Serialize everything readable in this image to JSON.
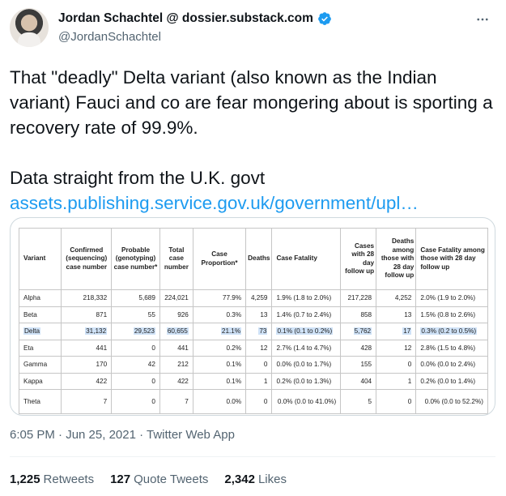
{
  "author": {
    "display_name": "Jordan Schachtel @ dossier.substack.com",
    "handle": "@JordanSchachtel"
  },
  "tweet": {
    "line1": "That \"deadly\" Delta variant (also known as the Indian variant) Fauci and co are fear mongering about is sporting a recovery rate of 99.9%.",
    "line2": "Data straight from the U.K. govt",
    "link": "assets.publishing.service.gov.uk/government/upl…"
  },
  "table": {
    "headers": {
      "variant": "Variant",
      "confirmed": "Confirmed (sequencing) case number",
      "probable": "Probable (genotyping) case number*",
      "total": "Total case number",
      "proportion": "Case Proportion*",
      "deaths": "Deaths",
      "cfr": "Case Fatality",
      "cases28": "Cases with 28 day follow up",
      "deaths28": "Deaths among those with 28 day follow up",
      "cfr28": "Case Fatality among those with 28 day follow up"
    },
    "rows": [
      {
        "variant": "Alpha",
        "confirmed": "218,332",
        "probable": "5,689",
        "total": "224,021",
        "proportion": "77.9%",
        "deaths": "4,259",
        "cfr": "1.9% (1.8 to 2.0%)",
        "cases28": "217,228",
        "deaths28": "4,252",
        "cfr28": "2.0% (1.9 to 2.0%)"
      },
      {
        "variant": "Beta",
        "confirmed": "871",
        "probable": "55",
        "total": "926",
        "proportion": "0.3%",
        "deaths": "13",
        "cfr": "1.4% (0.7 to 2.4%)",
        "cases28": "858",
        "deaths28": "13",
        "cfr28": "1.5% (0.8 to 2.6%)"
      },
      {
        "variant": "Delta",
        "confirmed": "31,132",
        "probable": "29,523",
        "total": "60,655",
        "proportion": "21.1%",
        "deaths": "73",
        "cfr": "0.1% (0.1 to 0.2%)",
        "cases28": "5,762",
        "deaths28": "17",
        "cfr28": "0.3% (0.2 to 0.5%)"
      },
      {
        "variant": "Eta",
        "confirmed": "441",
        "probable": "0",
        "total": "441",
        "proportion": "0.2%",
        "deaths": "12",
        "cfr": "2.7% (1.4 to 4.7%)",
        "cases28": "428",
        "deaths28": "12",
        "cfr28": "2.8% (1.5 to 4.8%)"
      },
      {
        "variant": "Gamma",
        "confirmed": "170",
        "probable": "42",
        "total": "212",
        "proportion": "0.1%",
        "deaths": "0",
        "cfr": "0.0% (0.0 to 1.7%)",
        "cases28": "155",
        "deaths28": "0",
        "cfr28": "0.0% (0.0 to 2.4%)"
      },
      {
        "variant": "Kappa",
        "confirmed": "422",
        "probable": "0",
        "total": "422",
        "proportion": "0.1%",
        "deaths": "1",
        "cfr": "0.2% (0.0 to 1.3%)",
        "cases28": "404",
        "deaths28": "1",
        "cfr28": "0.2% (0.0 to 1.4%)"
      },
      {
        "variant": "Theta",
        "confirmed": "7",
        "probable": "0",
        "total": "7",
        "proportion": "0.0%",
        "deaths": "0",
        "cfr": "0.0% (0.0 to 41.0%)",
        "cases28": "5",
        "deaths28": "0",
        "cfr28": "0.0% (0.0 to 52.2%)"
      }
    ],
    "highlight_color": "#cfe2f7"
  },
  "meta": {
    "timestamp": "6:05 PM · Jun 25, 2021 · Twitter Web App"
  },
  "stats": {
    "retweets_count": "1,225",
    "retweets_label": "Retweets",
    "quotes_count": "127",
    "quotes_label": "Quote Tweets",
    "likes_count": "2,342",
    "likes_label": "Likes"
  },
  "icons": {
    "verified": "verified-badge-icon",
    "more": "more-options-icon"
  },
  "colors": {
    "accent": "#1d9bf0",
    "text": "#0f1419",
    "secondary": "#536471",
    "border": "#cfd9de"
  }
}
